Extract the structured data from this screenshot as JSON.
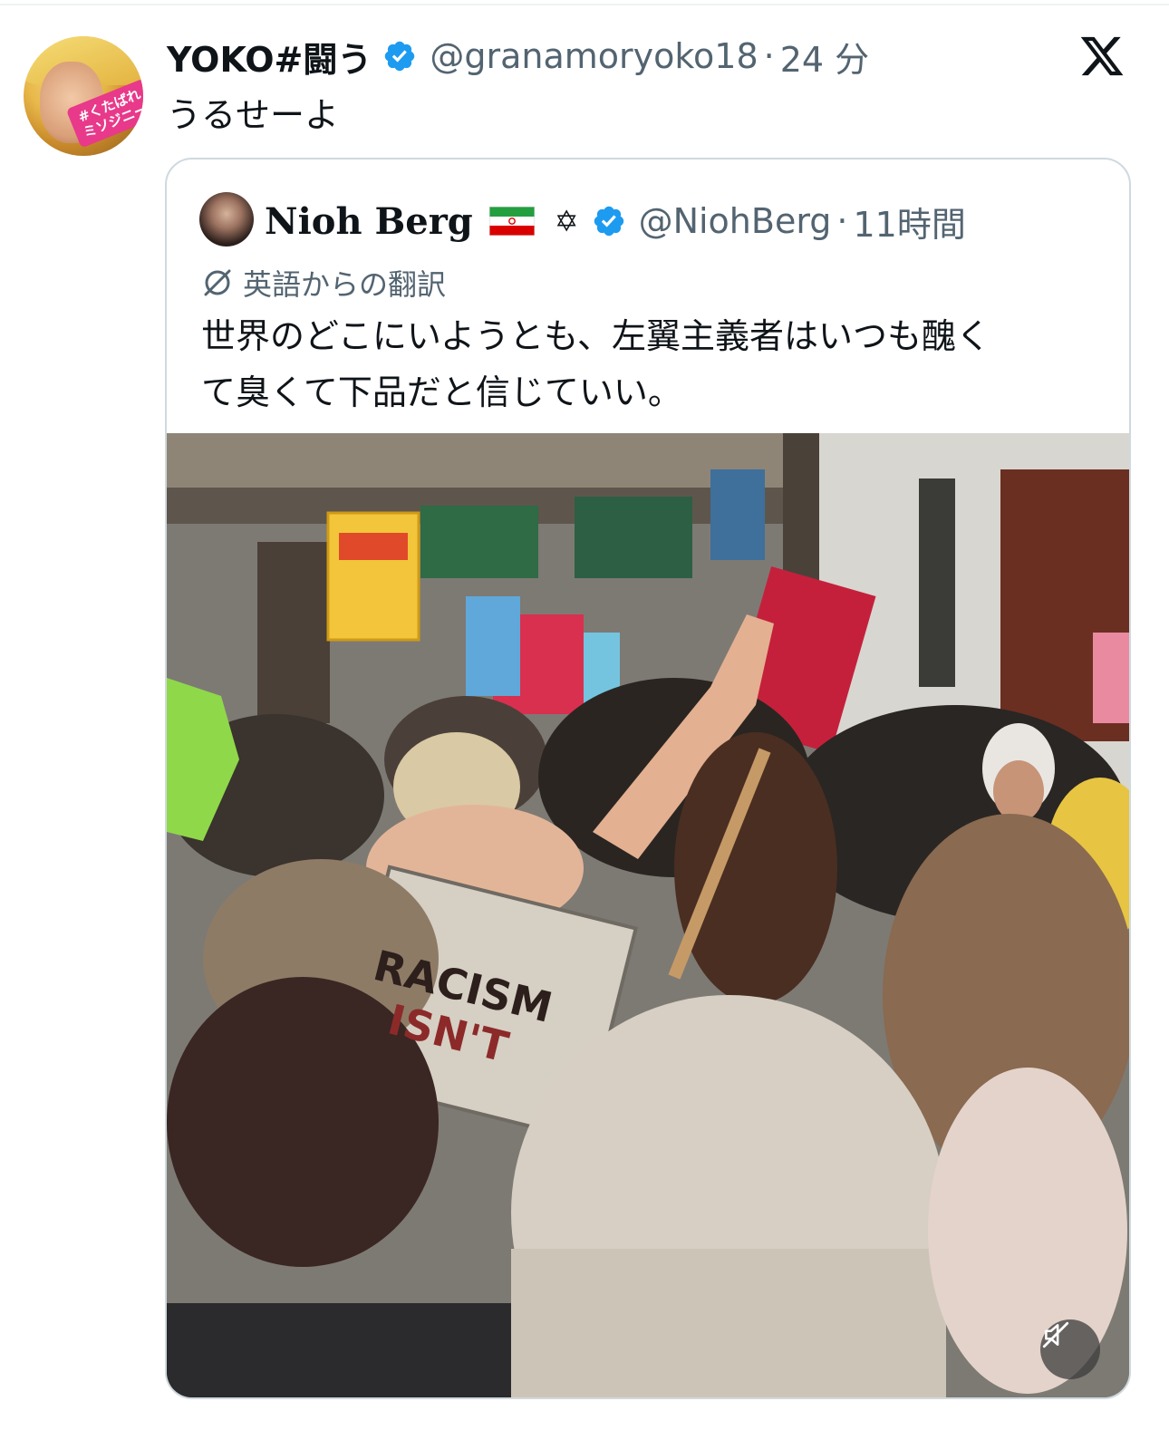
{
  "main_tweet": {
    "display_name": "YOKO#闘う",
    "handle": "@granamoryoko18",
    "separator": "·",
    "time": "24 分",
    "text": "うるせーよ",
    "avatar_badge_line1": "#くたばれ",
    "avatar_badge_line2": "ミソジニー"
  },
  "quoted_tweet": {
    "display_name": "Nioh Berg",
    "star_symbol": "✡",
    "handle": "@NiohBerg",
    "separator": "·",
    "time": "11時間",
    "translation_label": "英語からの翻訳",
    "text_line1": "世界のどこにいようとも、左翼主義者はいつも醜く",
    "text_line2": "て臭くて下品だと信じていい。",
    "media_sign_text1": "RACISM",
    "media_sign_text2": "ISN'T"
  },
  "colors": {
    "verified_blue": "#1d9bf0",
    "secondary_text": "#536471",
    "border": "#cfd9de",
    "avatar_badge": "#e8398a"
  },
  "icons": {
    "brand": "x-logo-icon",
    "verified": "verified-badge-icon",
    "translate": "translate-icon",
    "mute": "muted-speaker-icon",
    "flag": "iran-flag-icon"
  }
}
